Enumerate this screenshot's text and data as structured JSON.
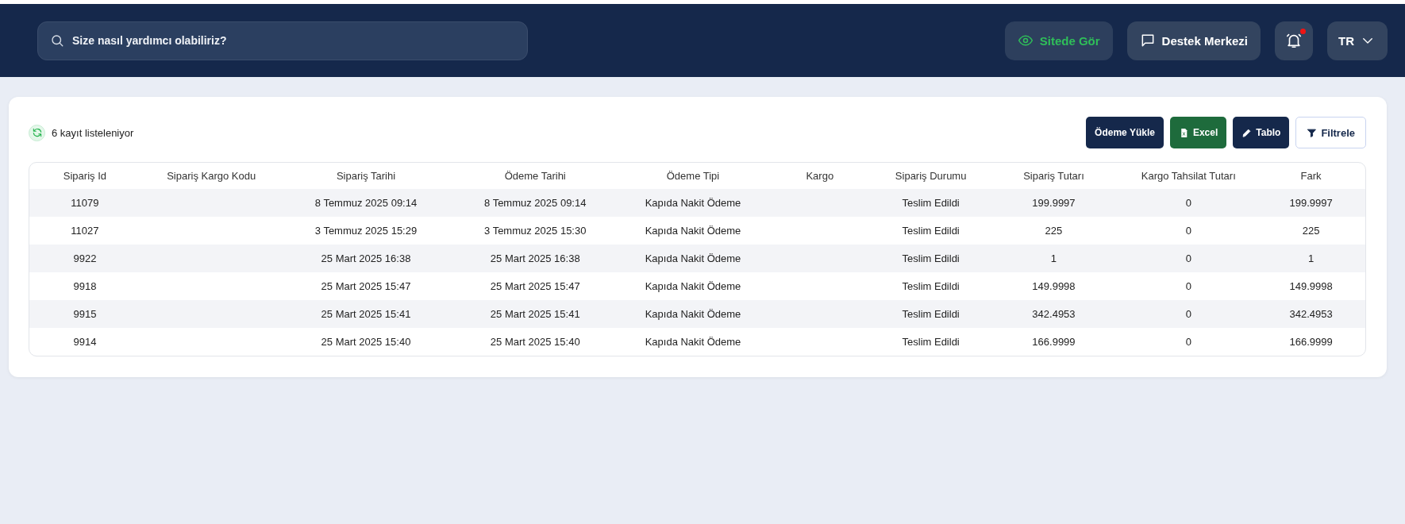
{
  "header": {
    "search": {
      "placeholder": "Size nasıl yardımcı olabiliriz?"
    },
    "actions": [
      {
        "kind": "view",
        "label": "Sitede Gör"
      },
      {
        "kind": "support",
        "label": "Destek Merkezi"
      },
      {
        "kind": "notifications",
        "unread": true
      },
      {
        "kind": "language",
        "label": "TR"
      }
    ]
  },
  "list": {
    "count_text": "6 kayıt listeleniyor",
    "buttons": [
      {
        "kind": "upload",
        "label": "Ödeme Yükle"
      },
      {
        "kind": "excel",
        "label": "Excel"
      },
      {
        "kind": "edit",
        "label": "Tablo"
      },
      {
        "kind": "filter",
        "label": "Filtrele"
      }
    ],
    "table": {
      "columns": [
        "Sipariş Id",
        "Sipariş Kargo Kodu",
        "Sipariş Tarihi",
        "Ödeme Tarihi",
        "Ödeme Tipi",
        "Kargo",
        "Sipariş Durumu",
        "Sipariş Tutarı",
        "Kargo Tahsilat Tutarı",
        "Fark"
      ],
      "rows": [
        [
          "11079",
          null,
          "8 Temmuz 2025 09:14",
          "8 Temmuz 2025 09:14",
          "Kapıda Nakit Ödeme",
          null,
          "Teslim Edildi",
          "199.9997",
          "0",
          "199.9997"
        ],
        [
          "11027",
          null,
          "3 Temmuz 2025 15:29",
          "3 Temmuz 2025 15:30",
          "Kapıda Nakit Ödeme",
          null,
          "Teslim Edildi",
          "225",
          "0",
          "225"
        ],
        [
          "9922",
          null,
          "25 Mart 2025 16:38",
          "25 Mart 2025 16:38",
          "Kapıda Nakit Ödeme",
          null,
          "Teslim Edildi",
          "1",
          "0",
          "1"
        ],
        [
          "9918",
          null,
          "25 Mart 2025 15:47",
          "25 Mart 2025 15:47",
          "Kapıda Nakit Ödeme",
          null,
          "Teslim Edildi",
          "149.9998",
          "0",
          "149.9998"
        ],
        [
          "9915",
          null,
          "25 Mart 2025 15:41",
          "25 Mart 2025 15:41",
          "Kapıda Nakit Ödeme",
          null,
          "Teslim Edildi",
          "342.4953",
          "0",
          "342.4953"
        ],
        [
          "9914",
          null,
          "25 Mart 2025 15:40",
          "25 Mart 2025 15:40",
          "Kapıda Nakit Ödeme",
          null,
          "Teslim Edildi",
          "166.9999",
          "0",
          "166.9999"
        ]
      ]
    }
  }
}
